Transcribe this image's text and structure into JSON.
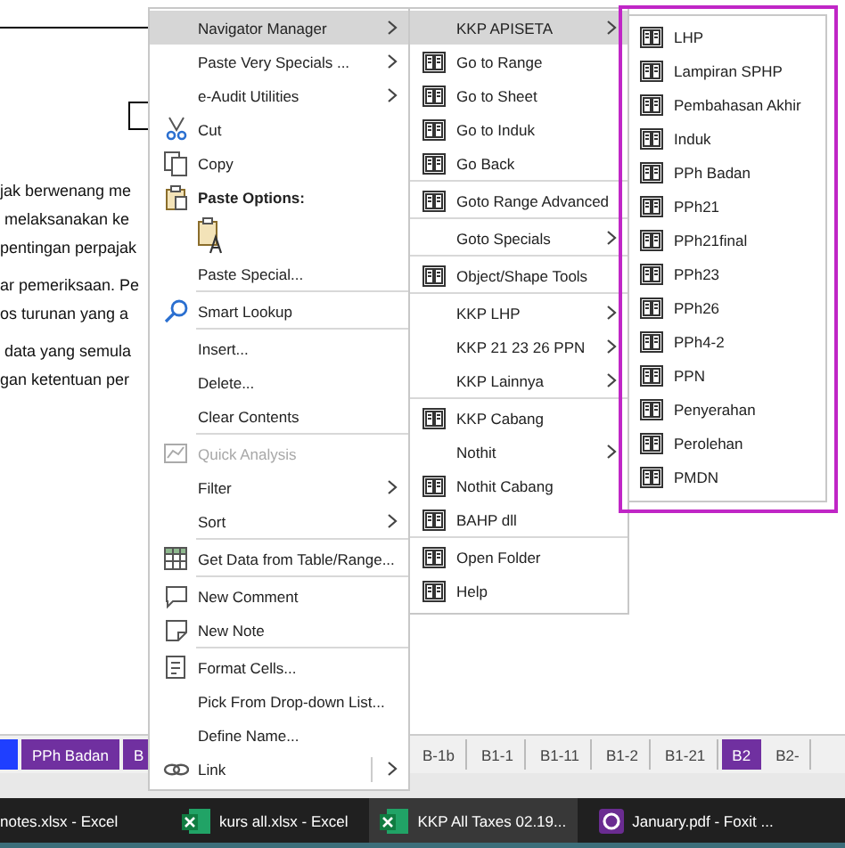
{
  "document": {
    "lines": [
      "jak berwenang me",
      " melaksanakan ke",
      "pentingan perpajak",
      "ar pemeriksaan. Pe",
      "os turunan yang a",
      " data yang semula",
      "gan ketentuan per"
    ]
  },
  "context_menu": {
    "items": [
      {
        "label": "Navigator Manager",
        "kind": "plain",
        "has_submenu": true,
        "selected": true,
        "disabled": false,
        "separator_above": false
      },
      {
        "label": "Paste Very Specials ...",
        "kind": "plain",
        "has_submenu": true,
        "selected": false,
        "disabled": false,
        "separator_above": false
      },
      {
        "label": "e-Audit Utilities",
        "kind": "plain",
        "has_submenu": true,
        "selected": false,
        "disabled": false,
        "separator_above": false
      },
      {
        "label": "Cut",
        "kind": "cut",
        "has_submenu": false,
        "selected": false,
        "disabled": false,
        "separator_above": false
      },
      {
        "label": "Copy",
        "kind": "copy",
        "has_submenu": false,
        "selected": false,
        "disabled": false,
        "separator_above": false
      },
      {
        "label": "Paste Options:",
        "kind": "header",
        "has_submenu": false,
        "selected": false,
        "disabled": false,
        "separator_above": false
      },
      {
        "kind": "paste-button"
      },
      {
        "label": "Paste Special...",
        "kind": "plain",
        "has_submenu": false,
        "selected": false,
        "disabled": false,
        "separator_above": false
      },
      {
        "label": "Smart Lookup",
        "kind": "lookup",
        "has_submenu": false,
        "selected": false,
        "disabled": false,
        "separator_above": true
      },
      {
        "label": "Insert...",
        "kind": "plain",
        "has_submenu": false,
        "selected": false,
        "disabled": false,
        "separator_above": true
      },
      {
        "label": "Delete...",
        "kind": "plain",
        "has_submenu": false,
        "selected": false,
        "disabled": false,
        "separator_above": false
      },
      {
        "label": "Clear Contents",
        "kind": "plain",
        "has_submenu": false,
        "selected": false,
        "disabled": false,
        "separator_above": false
      },
      {
        "label": "Quick Analysis",
        "kind": "analysis",
        "has_submenu": false,
        "selected": false,
        "disabled": true,
        "separator_above": true
      },
      {
        "label": "Filter",
        "kind": "plain",
        "has_submenu": true,
        "selected": false,
        "disabled": false,
        "separator_above": false
      },
      {
        "label": "Sort",
        "kind": "plain",
        "has_submenu": true,
        "selected": false,
        "disabled": false,
        "separator_above": false
      },
      {
        "label": "Get Data from Table/Range...",
        "kind": "table",
        "has_submenu": false,
        "selected": false,
        "disabled": false,
        "separator_above": true
      },
      {
        "label": "New Comment",
        "kind": "comment",
        "has_submenu": false,
        "selected": false,
        "disabled": false,
        "separator_above": true
      },
      {
        "label": "New Note",
        "kind": "note",
        "has_submenu": false,
        "selected": false,
        "disabled": false,
        "separator_above": false
      },
      {
        "label": "Format Cells...",
        "kind": "format",
        "has_submenu": false,
        "selected": false,
        "disabled": false,
        "separator_above": true
      },
      {
        "label": "Pick From Drop-down List...",
        "kind": "plain",
        "has_submenu": false,
        "selected": false,
        "disabled": false,
        "separator_above": false
      },
      {
        "label": "Define Name...",
        "kind": "plain",
        "has_submenu": false,
        "selected": false,
        "disabled": false,
        "separator_above": false
      },
      {
        "label": "Link",
        "kind": "link",
        "has_submenu": true,
        "selected": false,
        "disabled": false,
        "separator_above": false
      }
    ]
  },
  "navigator_submenu": {
    "items": [
      {
        "label": "KKP APISETA",
        "has_icon": false,
        "has_submenu": true,
        "selected": true,
        "separator_above": false
      },
      {
        "label": "Go to Range",
        "has_icon": true,
        "has_submenu": false,
        "selected": false,
        "separator_above": false
      },
      {
        "label": "Go to Sheet",
        "has_icon": true,
        "has_submenu": false,
        "selected": false,
        "separator_above": false
      },
      {
        "label": "Go to Induk",
        "has_icon": true,
        "has_submenu": false,
        "selected": false,
        "separator_above": false
      },
      {
        "label": "Go Back",
        "has_icon": true,
        "has_submenu": false,
        "selected": false,
        "separator_above": false
      },
      {
        "label": "Goto Range Advanced",
        "has_icon": true,
        "has_submenu": false,
        "selected": false,
        "separator_above": true
      },
      {
        "label": "Goto Specials",
        "has_icon": false,
        "has_submenu": true,
        "selected": false,
        "separator_above": true
      },
      {
        "label": "Object/Shape Tools",
        "has_icon": true,
        "has_submenu": false,
        "selected": false,
        "separator_above": true
      },
      {
        "label": "KKP LHP",
        "has_icon": false,
        "has_submenu": true,
        "selected": false,
        "separator_above": true
      },
      {
        "label": "KKP 21 23 26 PPN",
        "has_icon": false,
        "has_submenu": true,
        "selected": false,
        "separator_above": false
      },
      {
        "label": "KKP Lainnya",
        "has_icon": false,
        "has_submenu": true,
        "selected": false,
        "separator_above": false
      },
      {
        "label": "KKP Cabang",
        "has_icon": true,
        "has_submenu": false,
        "selected": false,
        "separator_above": true
      },
      {
        "label": "Nothit",
        "has_icon": false,
        "has_submenu": true,
        "selected": false,
        "separator_above": false
      },
      {
        "label": "Nothit Cabang",
        "has_icon": true,
        "has_submenu": false,
        "selected": false,
        "separator_above": false
      },
      {
        "label": "BAHP dll",
        "has_icon": true,
        "has_submenu": false,
        "selected": false,
        "separator_above": false
      },
      {
        "label": "Open Folder",
        "has_icon": true,
        "has_submenu": false,
        "selected": false,
        "separator_above": true
      },
      {
        "label": "Help",
        "has_icon": true,
        "has_submenu": false,
        "selected": false,
        "separator_above": false
      }
    ]
  },
  "apiseta_submenu": {
    "items": [
      {
        "label": "LHP"
      },
      {
        "label": "Lampiran SPHP"
      },
      {
        "label": "Pembahasan Akhir"
      },
      {
        "label": "Induk"
      },
      {
        "label": "PPh Badan"
      },
      {
        "label": "PPh21"
      },
      {
        "label": "PPh21final"
      },
      {
        "label": "PPh23"
      },
      {
        "label": "PPh26"
      },
      {
        "label": "PPh4-2"
      },
      {
        "label": "PPN"
      },
      {
        "label": "Penyerahan"
      },
      {
        "label": "Perolehan"
      },
      {
        "label": "PMDN"
      }
    ]
  },
  "sheet_tabs": {
    "left": [
      {
        "color": "#1f3fff"
      },
      {
        "label": "PPh Badan",
        "color": "#7030a0"
      },
      {
        "label": "B",
        "color": "#7030a0"
      }
    ],
    "right": [
      {
        "label": "B-1b"
      },
      {
        "label": "B1-1"
      },
      {
        "label": "B1-11"
      },
      {
        "label": "B1-2"
      },
      {
        "label": "B1-21"
      },
      {
        "label": "B2",
        "color": "#7030a0"
      },
      {
        "label": "B2-"
      }
    ]
  },
  "taskbar": {
    "items": [
      {
        "label": "notes.xlsx - Excel",
        "kind": "plain",
        "selected": false
      },
      {
        "label": "kurs all.xlsx - Excel",
        "kind": "spreadsheet",
        "selected": false
      },
      {
        "label": "KKP All Taxes 02.19...",
        "kind": "spreadsheet",
        "selected": true
      },
      {
        "label": "January.pdf - Foxit ...",
        "kind": "pdf",
        "selected": false
      }
    ]
  }
}
